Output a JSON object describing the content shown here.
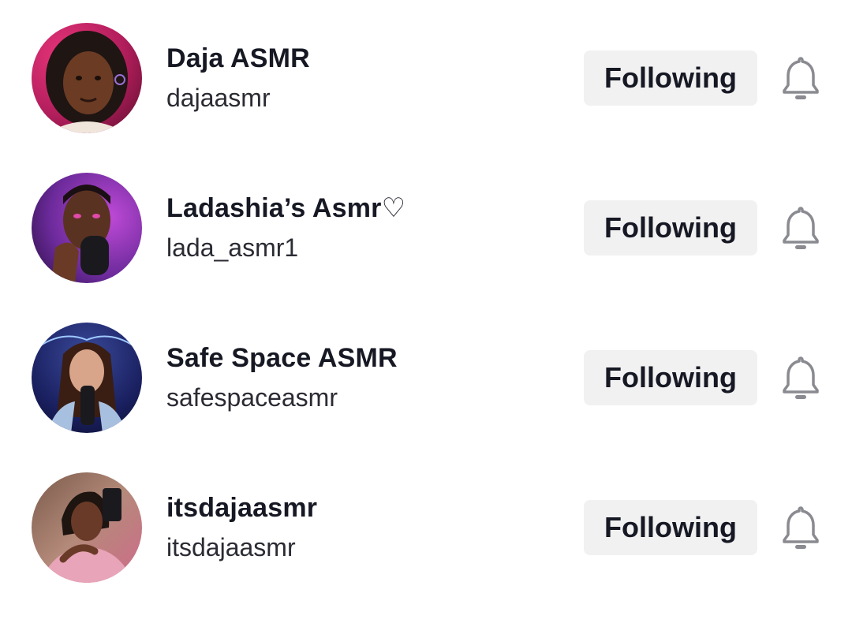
{
  "following_list": [
    {
      "display_name": "Daja ASMR",
      "username": "dajaasmr",
      "button_label": "Following",
      "avatar_icon": "avatar-photo-icon",
      "bell_icon": "bell-icon"
    },
    {
      "display_name": "Ladashia’s Asmr♡",
      "username": "lada_asmr1",
      "button_label": "Following",
      "avatar_icon": "avatar-photo-icon",
      "bell_icon": "bell-icon"
    },
    {
      "display_name": "Safe Space ASMR",
      "username": "safespaceasmr",
      "button_label": "Following",
      "avatar_icon": "avatar-photo-icon",
      "bell_icon": "bell-icon"
    },
    {
      "display_name": "itsdajaasmr",
      "username": "itsdajaasmr",
      "button_label": "Following",
      "avatar_icon": "avatar-photo-icon",
      "bell_icon": "bell-icon"
    }
  ],
  "colors": {
    "button_bg": "#f1f1f2",
    "text_primary": "#161823",
    "icon_gray": "#8a8b91"
  }
}
